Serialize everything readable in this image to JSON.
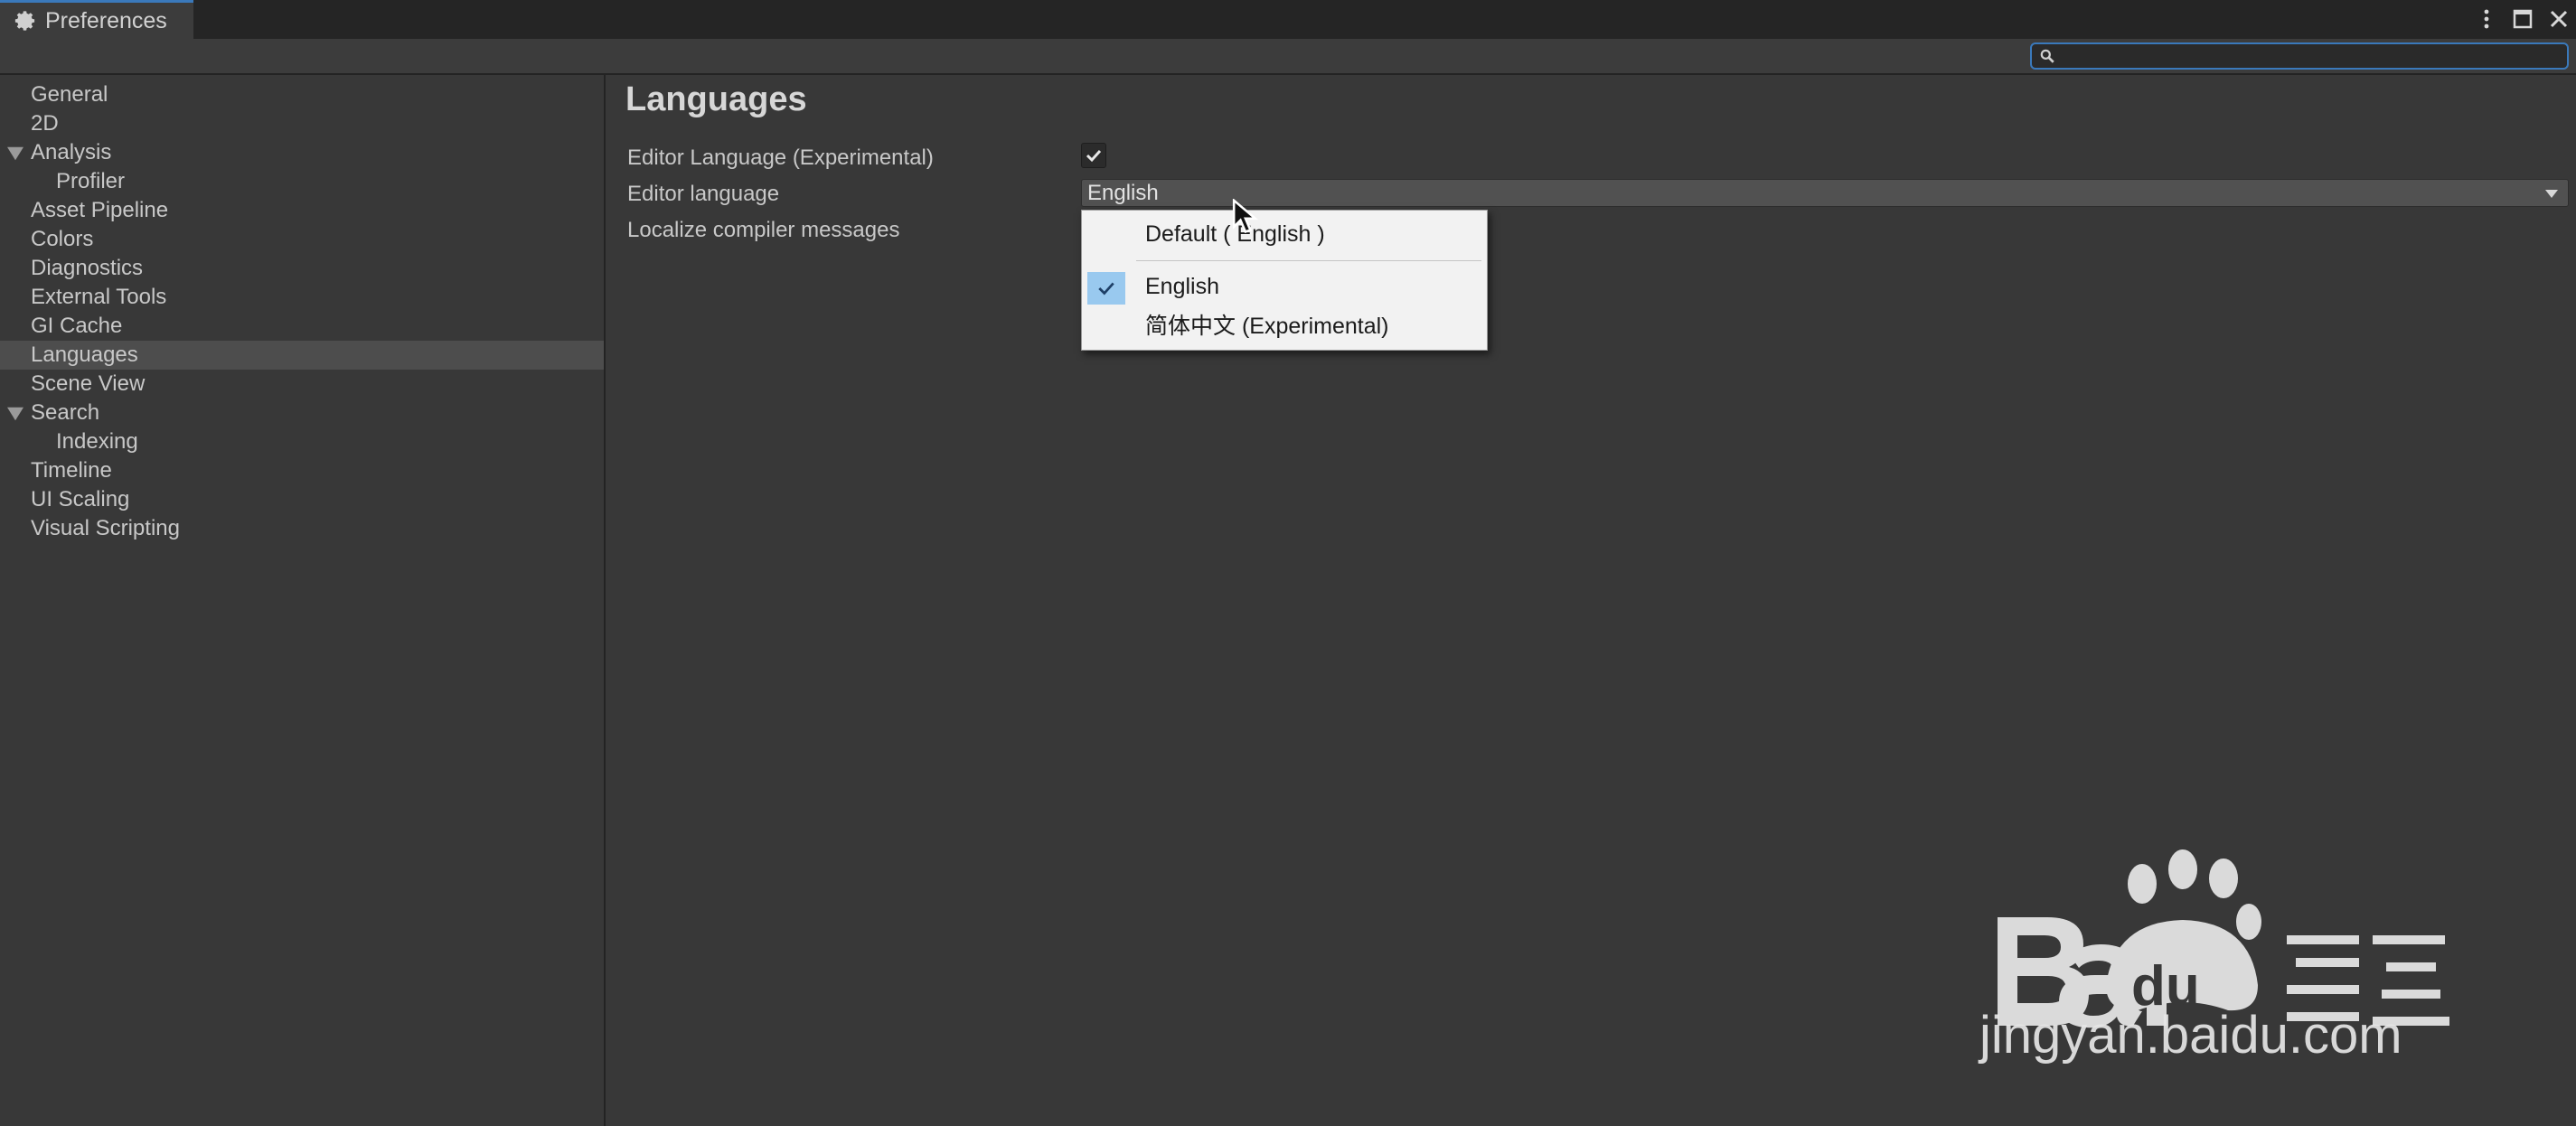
{
  "window": {
    "tab_title": "Preferences"
  },
  "search": {
    "value": "",
    "placeholder": ""
  },
  "sidebar": {
    "items": [
      {
        "label": "General",
        "indent": 0,
        "expandable": false,
        "selected": false
      },
      {
        "label": "2D",
        "indent": 0,
        "expandable": false,
        "selected": false
      },
      {
        "label": "Analysis",
        "indent": 0,
        "expandable": true,
        "selected": false
      },
      {
        "label": "Profiler",
        "indent": 1,
        "expandable": false,
        "selected": false
      },
      {
        "label": "Asset Pipeline",
        "indent": 0,
        "expandable": false,
        "selected": false
      },
      {
        "label": "Colors",
        "indent": 0,
        "expandable": false,
        "selected": false
      },
      {
        "label": "Diagnostics",
        "indent": 0,
        "expandable": false,
        "selected": false
      },
      {
        "label": "External Tools",
        "indent": 0,
        "expandable": false,
        "selected": false
      },
      {
        "label": "GI Cache",
        "indent": 0,
        "expandable": false,
        "selected": false
      },
      {
        "label": "Languages",
        "indent": 0,
        "expandable": false,
        "selected": true
      },
      {
        "label": "Scene View",
        "indent": 0,
        "expandable": false,
        "selected": false
      },
      {
        "label": "Search",
        "indent": 0,
        "expandable": true,
        "selected": false
      },
      {
        "label": "Indexing",
        "indent": 1,
        "expandable": false,
        "selected": false
      },
      {
        "label": "Timeline",
        "indent": 0,
        "expandable": false,
        "selected": false
      },
      {
        "label": "UI Scaling",
        "indent": 0,
        "expandable": false,
        "selected": false
      },
      {
        "label": "Visual Scripting",
        "indent": 0,
        "expandable": false,
        "selected": false
      }
    ]
  },
  "main": {
    "section_title": "Languages",
    "editor_language_experimental_label": "Editor Language (Experimental)",
    "editor_language_experimental_checked": true,
    "editor_language_label": "Editor language",
    "editor_language_value": "English",
    "localize_compiler_label": "Localize compiler messages"
  },
  "language_menu": {
    "options": [
      {
        "label": "Default ( English )",
        "checked": false
      },
      {
        "label": "English",
        "checked": true
      },
      {
        "label": "简体中文 (Experimental)",
        "checked": false
      }
    ]
  },
  "watermark": {
    "brand": "Bai du 经验",
    "url": "jingyan.baidu.com"
  },
  "colors": {
    "accent": "#3a79bb",
    "selection": "#4d4d4d",
    "menu_check_bg": "#99c9ef",
    "background": "#383838"
  }
}
